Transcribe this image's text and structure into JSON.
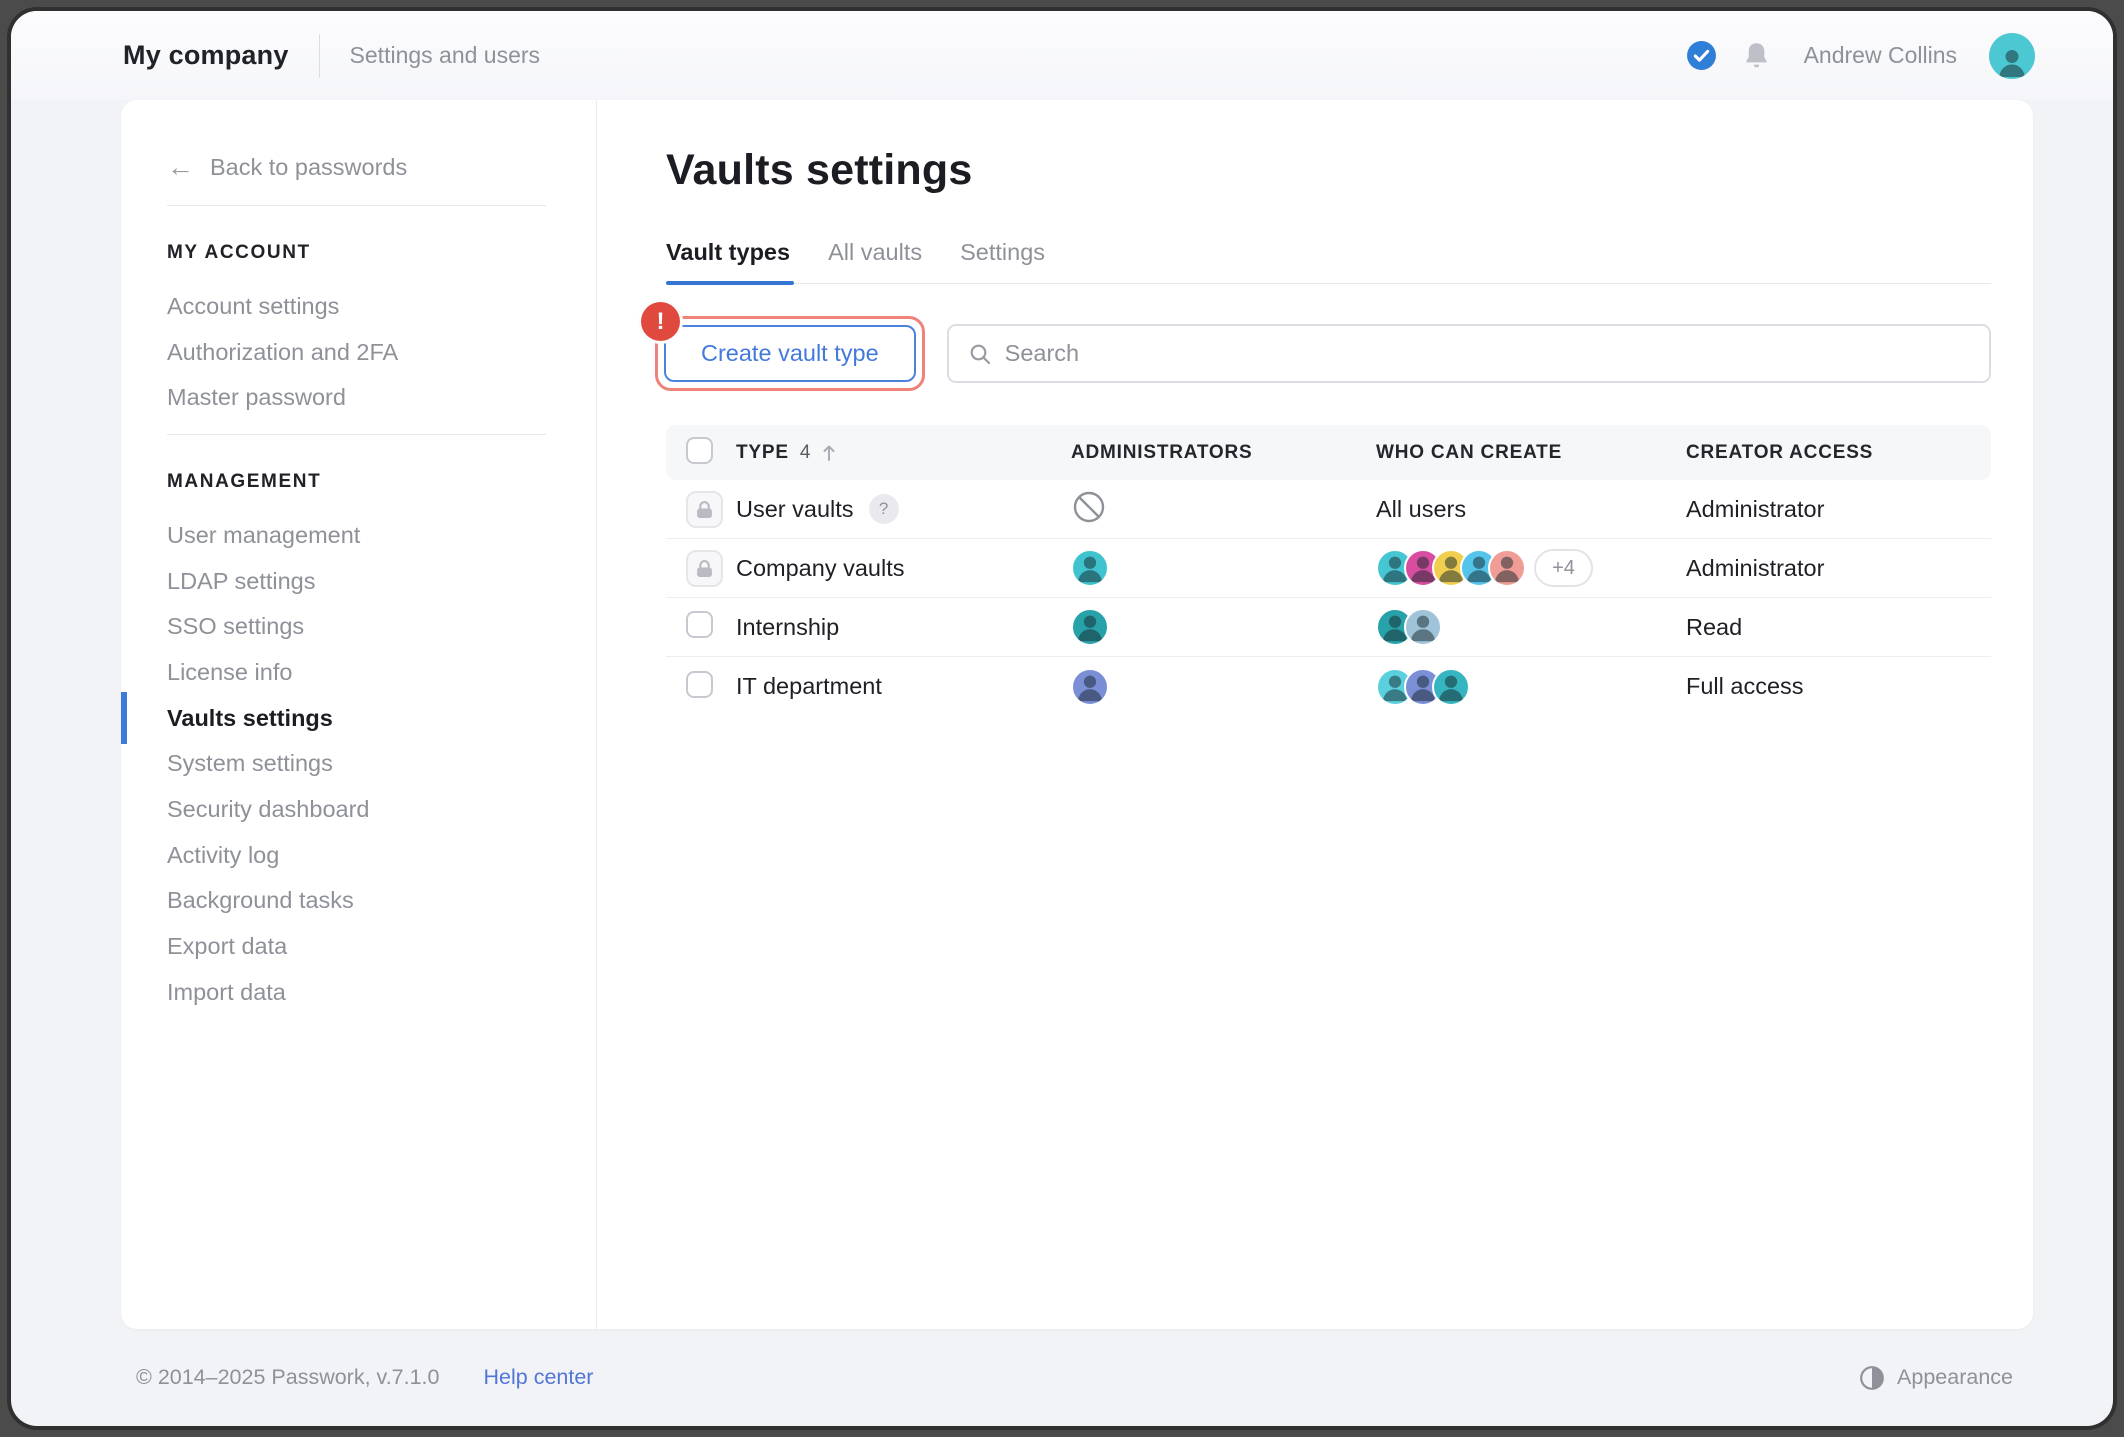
{
  "header": {
    "company_name": "My company",
    "section_title": "Settings and users",
    "user_name": "Andrew Collins",
    "avatar_color": "#4cc8d2",
    "icons": [
      "check-circle-icon",
      "bell-icon"
    ]
  },
  "sidebar": {
    "back_label": "Back to passwords",
    "back_icon": "←",
    "sections": [
      {
        "title": "MY ACCOUNT",
        "items": [
          {
            "label": "Account settings",
            "active": false
          },
          {
            "label": "Authorization and 2FA",
            "active": false
          },
          {
            "label": "Master password",
            "active": false
          }
        ]
      },
      {
        "title": "MANAGEMENT",
        "items": [
          {
            "label": "User management",
            "active": false
          },
          {
            "label": "LDAP settings",
            "active": false
          },
          {
            "label": "SSO settings",
            "active": false
          },
          {
            "label": "License info",
            "active": false
          },
          {
            "label": "Vaults settings",
            "active": true
          },
          {
            "label": "System settings",
            "active": false
          },
          {
            "label": "Security dashboard",
            "active": false
          },
          {
            "label": "Activity log",
            "active": false
          },
          {
            "label": "Background tasks",
            "active": false
          },
          {
            "label": "Export data",
            "active": false
          },
          {
            "label": "Import data",
            "active": false
          }
        ]
      }
    ]
  },
  "main": {
    "title": "Vaults settings",
    "tabs": [
      {
        "label": "Vault types",
        "active": true
      },
      {
        "label": "All vaults",
        "active": false
      },
      {
        "label": "Settings",
        "active": false
      }
    ],
    "toolbar": {
      "create_button_label": "Create vault type",
      "annotation_badge": "!",
      "search_placeholder": "Search",
      "search_value": ""
    },
    "table": {
      "header": {
        "type_label": "TYPE",
        "count": "4",
        "sort_direction": "asc",
        "administrators_label": "ADMINISTRATORS",
        "who_can_create_label": "WHO CAN CREATE",
        "creator_access_label": "CREATOR ACCESS"
      },
      "rows": [
        {
          "name": "User vaults",
          "leading": "lock",
          "help_badge": "?",
          "administrators": {
            "type": "none"
          },
          "who_can_create": {
            "type": "text",
            "text": "All users"
          },
          "creator_access": "Administrator"
        },
        {
          "name": "Company vaults",
          "leading": "lock",
          "help_badge": null,
          "administrators": {
            "type": "avatars",
            "avatars": [
              "#3fc3cf"
            ]
          },
          "who_can_create": {
            "type": "avatars",
            "avatars": [
              "#46c6d2",
              "#d84da0",
              "#f0cf4e",
              "#54c4ea",
              "#ef9d96"
            ],
            "extra": "+4"
          },
          "creator_access": "Administrator"
        },
        {
          "name": "Internship",
          "leading": "checkbox",
          "help_badge": null,
          "administrators": {
            "type": "avatars",
            "avatars": [
              "#27a2a8"
            ]
          },
          "who_can_create": {
            "type": "avatars",
            "avatars": [
              "#27a2a8",
              "#9fc3d8"
            ],
            "extra": null
          },
          "creator_access": "Read"
        },
        {
          "name": "IT department",
          "leading": "checkbox",
          "help_badge": null,
          "administrators": {
            "type": "avatars",
            "avatars": [
              "#7b8fd6"
            ]
          },
          "who_can_create": {
            "type": "avatars",
            "avatars": [
              "#5ad0de",
              "#7b8fd6",
              "#35b5bf"
            ],
            "extra": null
          },
          "creator_access": "Full access"
        }
      ]
    }
  },
  "footer": {
    "copyright": "© 2014–2025 Passwork, v.7.1.0",
    "help_link": "Help center",
    "appearance_label": "Appearance",
    "appearance_icon": "contrast-half-circle"
  },
  "colors": {
    "accent_blue": "#3575d3",
    "link_blue": "#5276d8",
    "annotation_red_ring": "#ef837a",
    "annotation_red_badge": "#e04a3e",
    "check_badge_blue": "#2f7ed8"
  }
}
